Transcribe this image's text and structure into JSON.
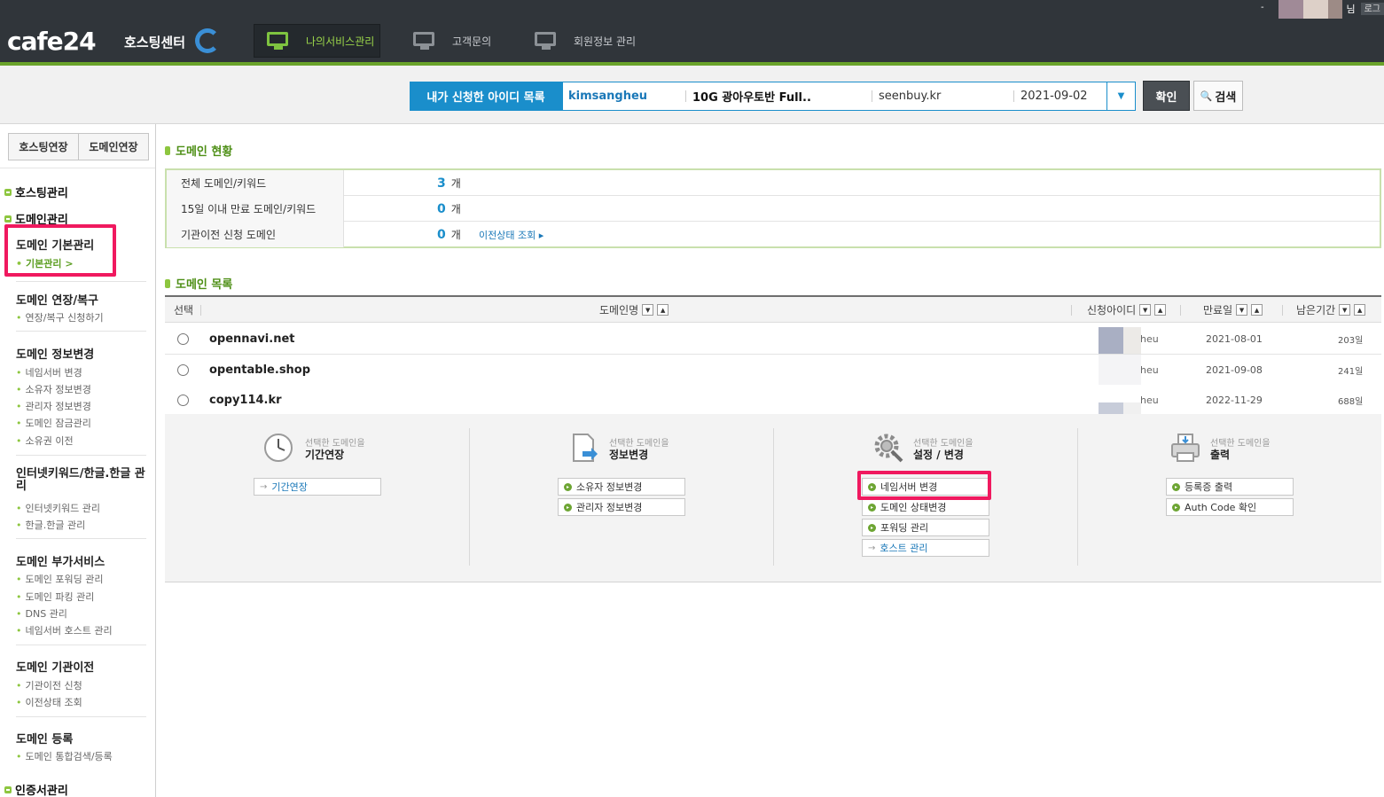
{
  "header": {
    "logo": "cafe24",
    "logo_sub": "호스팅센터",
    "nav": [
      {
        "label": "나의서비스관리",
        "icon": "my-service-icon"
      },
      {
        "label": "고객문의",
        "icon": "support-icon"
      },
      {
        "label": "회원정보 관리",
        "icon": "member-icon"
      }
    ],
    "user_suffix": "님",
    "logout": "로그",
    "dash": "-"
  },
  "id_selector": {
    "label": "내가 신청한 아이디 목록",
    "id": "kimsangheu",
    "product": "10G 광아우토반 Full..",
    "domain": "seenbuy.kr",
    "date": "2021-09-02",
    "confirm": "확인",
    "search": "검색"
  },
  "sidebar": {
    "tabs": [
      "호스팅연장",
      "도메인연장"
    ],
    "categories": [
      "호스팅관리",
      "도메인관리",
      "인증서관리"
    ],
    "groups": [
      {
        "title": "도메인 기본관리",
        "links": [
          "기본관리 >"
        ]
      },
      {
        "title": "도메인 연장/복구",
        "links": [
          "연장/복구 신청하기"
        ]
      },
      {
        "title": "도메인 정보변경",
        "links": [
          "네임서버 변경",
          "소유자 정보변경",
          "관리자 정보변경",
          "도메인 잠금관리",
          "소유권 이전"
        ]
      },
      {
        "title": "인터넷키워드/한글.한글 관리",
        "links": [
          "인터넷키워드 관리",
          "한글.한글 관리"
        ]
      },
      {
        "title": "도메인 부가서비스",
        "links": [
          "도메인 포워딩 관리",
          "도메인 파킹 관리",
          "DNS 관리",
          "네임서버 호스트 관리"
        ]
      },
      {
        "title": "도메인 기관이전",
        "links": [
          "기관이전 신청",
          "이전상태 조회"
        ]
      },
      {
        "title": "도메인 등록",
        "links": [
          "도메인 통합검색/등록"
        ]
      }
    ]
  },
  "status": {
    "title": "도메인 현황",
    "rows": [
      {
        "label": "전체 도메인/키워드",
        "count": "3",
        "unit": "개"
      },
      {
        "label": "15일 이내 만료 도메인/키워드",
        "count": "0",
        "unit": "개"
      },
      {
        "label": "기관이전 신청 도메인",
        "count": "0",
        "unit": "개",
        "link": "이전상태 조회 ▸"
      }
    ]
  },
  "domain_list": {
    "title": "도메인 목록",
    "headers": {
      "select": "선택",
      "name": "도메인명",
      "id": "신청아이디",
      "expire": "만료일",
      "remain": "남은기간"
    },
    "rows": [
      {
        "name": "opennavi.net",
        "id": "heu",
        "expire": "2021-08-01",
        "remain": "203일"
      },
      {
        "name": "opentable.shop",
        "id": "heu",
        "expire": "2021-09-08",
        "remain": "241일"
      },
      {
        "name": "copy114.kr",
        "id": "heu",
        "expire": "2022-11-29",
        "remain": "688일"
      }
    ]
  },
  "actions": {
    "caption": "선택한 도메인을",
    "columns": [
      {
        "title": "기간연장",
        "buttons": [
          "기간연장"
        ]
      },
      {
        "title": "정보변경",
        "buttons": [
          "소유자 정보변경",
          "관리자 정보변경"
        ]
      },
      {
        "title": "설정 / 변경",
        "buttons": [
          "네임서버 변경",
          "도메인 상태변경",
          "포워딩 관리",
          "호스트 관리"
        ]
      },
      {
        "title": "출력",
        "buttons": [
          "등록증 출력",
          "Auth Code 확인"
        ]
      }
    ]
  }
}
